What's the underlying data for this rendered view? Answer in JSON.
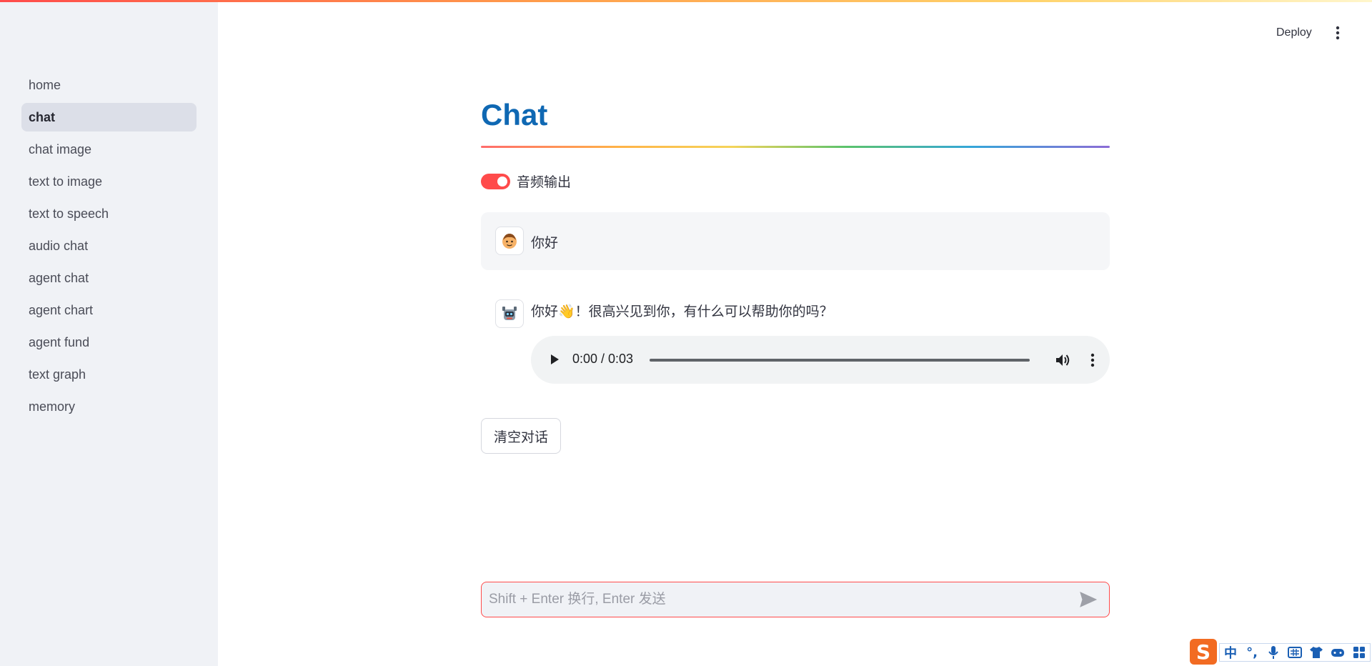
{
  "header": {
    "deploy_label": "Deploy",
    "menu_icon": "kebab-menu-icon"
  },
  "sidebar": {
    "items": [
      {
        "label": "home",
        "active": false
      },
      {
        "label": "chat",
        "active": true
      },
      {
        "label": "chat image",
        "active": false
      },
      {
        "label": "text to image",
        "active": false
      },
      {
        "label": "text to speech",
        "active": false
      },
      {
        "label": "audio chat",
        "active": false
      },
      {
        "label": "agent chat",
        "active": false
      },
      {
        "label": "agent chart",
        "active": false
      },
      {
        "label": "agent fund",
        "active": false
      },
      {
        "label": "text graph",
        "active": false
      },
      {
        "label": "memory",
        "active": false
      }
    ]
  },
  "main": {
    "title": "Chat",
    "audio_toggle": {
      "label": "音频输出",
      "on": true
    },
    "messages": [
      {
        "role": "user",
        "avatar_icon": "user-face-icon",
        "text": "你好"
      },
      {
        "role": "assistant",
        "avatar_icon": "robot-icon",
        "text": "你好👋！很高兴见到你，有什么可以帮助你的吗？",
        "audio": {
          "time": "0:00 / 0:03",
          "progress": 0
        }
      }
    ],
    "clear_button": "清空对话",
    "chat_input": {
      "placeholder": "Shift + Enter 换行, Enter 发送",
      "value": ""
    }
  },
  "ime": {
    "logo": "S",
    "mode_char": "中",
    "punct": "°,"
  },
  "colors": {
    "accent": "#ff4b4b",
    "title": "#0f68b3",
    "sidebar_bg": "#f0f2f6"
  }
}
